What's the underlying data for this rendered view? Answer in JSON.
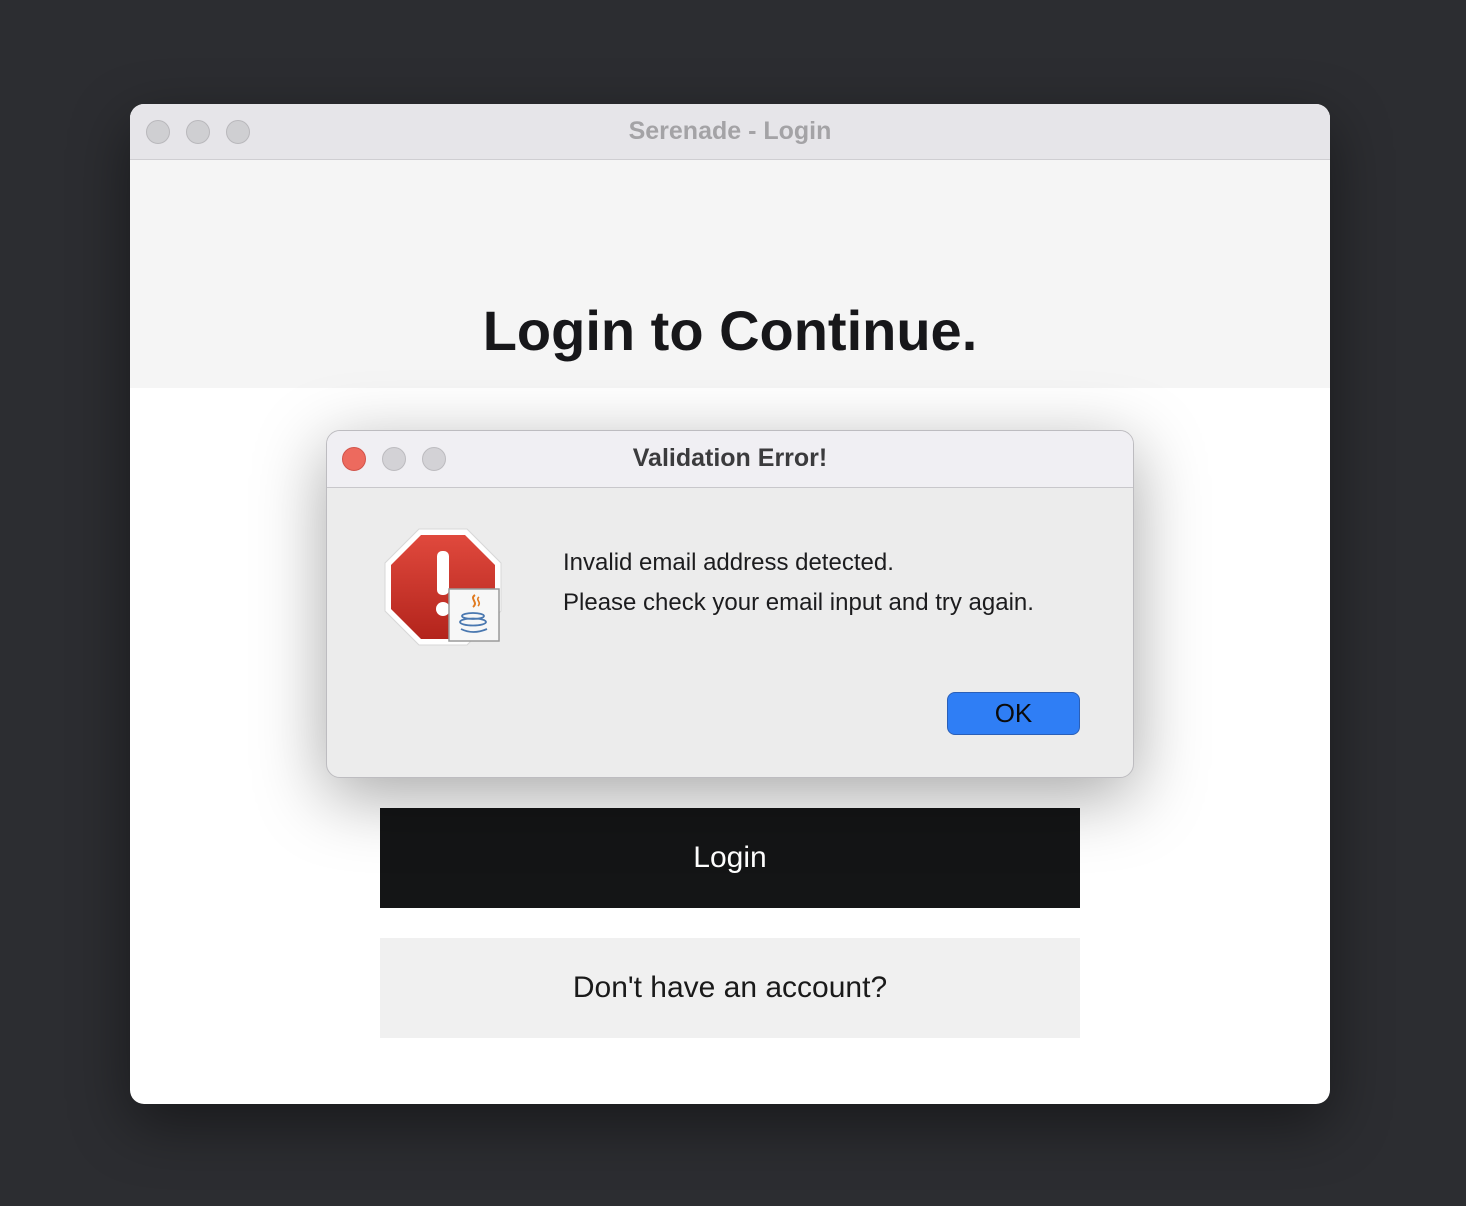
{
  "main_window": {
    "title": "Serenade - Login",
    "heading": "Login to Continue.",
    "login_label": "Login",
    "signup_label": "Don't have an account?"
  },
  "dialog": {
    "title": "Validation Error!",
    "message_line1": "Invalid email address detected.",
    "message_line2": "Please check your email input and try again.",
    "ok_label": "OK",
    "icon": "error-stop-sign-icon"
  },
  "colors": {
    "desktop": "#2c2d31",
    "accent_blue": "#2f7ef5",
    "login_button": "#141516",
    "close_red": "#ed6a5e",
    "error_red": "#c8332a"
  }
}
